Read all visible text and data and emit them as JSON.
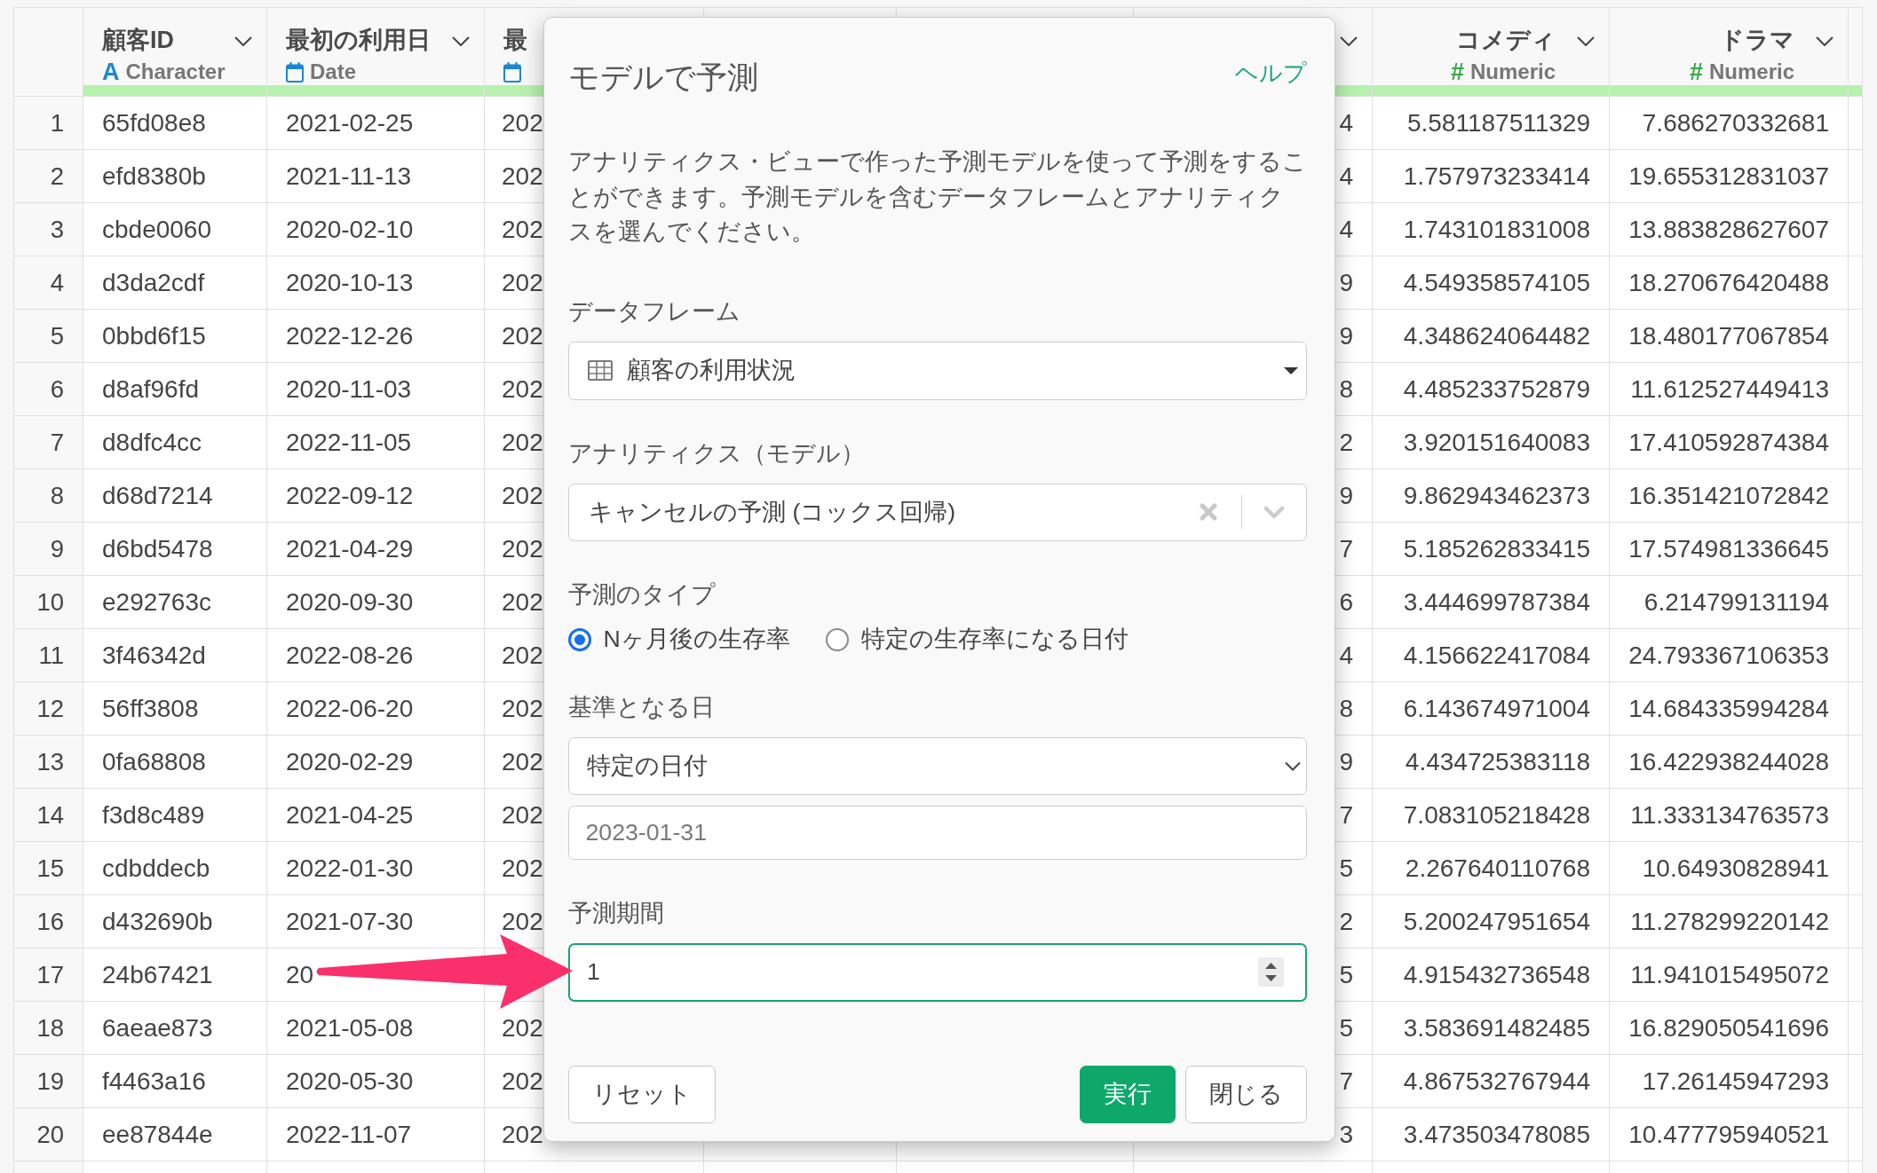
{
  "table": {
    "columns": [
      {
        "kind": "character",
        "name": "顧客ID",
        "type_mark": "A",
        "type_label": "Character",
        "menu": true
      },
      {
        "kind": "date",
        "name": "最初の利用日",
        "type_label": "Date",
        "menu": true
      },
      {
        "kind": "date",
        "name": "最"
      },
      {
        "kind": "numeric",
        "menu": true
      },
      {
        "kind": "numeric",
        "name": "コメディ",
        "type_mark": "#",
        "type_label": "Numeric",
        "menu": true
      },
      {
        "kind": "numeric",
        "name": "ドラマ",
        "type_mark": "#",
        "type_label": "Numeric",
        "menu": true
      }
    ],
    "rows": [
      {
        "number": "1",
        "cells": [
          "65fd08e8",
          "2021-02-25",
          "202",
          "4",
          "5.581187511329",
          "7.686270332681"
        ]
      },
      {
        "number": "2",
        "cells": [
          "efd8380b",
          "2021-11-13",
          "202",
          "4",
          "1.757973233414",
          "19.655312831037"
        ]
      },
      {
        "number": "3",
        "cells": [
          "cbde0060",
          "2020-02-10",
          "202",
          "4",
          "1.743101831008",
          "13.883828627607"
        ]
      },
      {
        "number": "4",
        "cells": [
          "d3da2cdf",
          "2020-10-13",
          "202",
          "9",
          "4.549358574105",
          "18.270676420488"
        ]
      },
      {
        "number": "5",
        "cells": [
          "0bbd6f15",
          "2022-12-26",
          "202",
          "9",
          "4.348624064482",
          "18.480177067854"
        ]
      },
      {
        "number": "6",
        "cells": [
          "d8af96fd",
          "2020-11-03",
          "202",
          "8",
          "4.485233752879",
          "11.612527449413"
        ]
      },
      {
        "number": "7",
        "cells": [
          "d8dfc4cc",
          "2022-11-05",
          "202",
          "2",
          "3.920151640083",
          "17.410592874384"
        ]
      },
      {
        "number": "8",
        "cells": [
          "d68d7214",
          "2022-09-12",
          "202",
          "9",
          "9.862943462373",
          "16.351421072842"
        ]
      },
      {
        "number": "9",
        "cells": [
          "d6bd5478",
          "2021-04-29",
          "202",
          "7",
          "5.185262833415",
          "17.574981336645"
        ]
      },
      {
        "number": "10",
        "cells": [
          "e292763c",
          "2020-09-30",
          "202",
          "6",
          "3.444699787384",
          "6.214799131194"
        ]
      },
      {
        "number": "11",
        "cells": [
          "3f46342d",
          "2022-08-26",
          "202",
          "4",
          "4.156622417084",
          "24.793367106353"
        ]
      },
      {
        "number": "12",
        "cells": [
          "56ff3808",
          "2022-06-20",
          "202",
          "8",
          "6.143674971004",
          "14.684335994284"
        ]
      },
      {
        "number": "13",
        "cells": [
          "0fa68808",
          "2020-02-29",
          "202",
          "9",
          "4.434725383118",
          "16.422938244028"
        ]
      },
      {
        "number": "14",
        "cells": [
          "f3d8c489",
          "2021-04-25",
          "202",
          "7",
          "7.083105218428",
          "11.333134763573"
        ]
      },
      {
        "number": "15",
        "cells": [
          "cdbddecb",
          "2022-01-30",
          "202",
          "5",
          "2.267640110768",
          "10.64930828941"
        ]
      },
      {
        "number": "16",
        "cells": [
          "d432690b",
          "2021-07-30",
          "202",
          "2",
          "5.200247951654",
          "11.278299220142"
        ]
      },
      {
        "number": "17",
        "cells": [
          "24b67421",
          "20",
          null,
          "5",
          "4.915432736548",
          "11.941015495072"
        ]
      },
      {
        "number": "18",
        "cells": [
          "6aeae873",
          "2021-05-08",
          "202",
          "5",
          "3.583691482485",
          "16.829050541696"
        ]
      },
      {
        "number": "19",
        "cells": [
          "f4463a16",
          "2020-05-30",
          "202",
          "7",
          "4.867532767944",
          "17.26145947293"
        ]
      },
      {
        "number": "20",
        "cells": [
          "ee87844e",
          "2022-11-07",
          "202",
          "3",
          "3.473503478085",
          "10.477795940521"
        ]
      }
    ]
  },
  "modal": {
    "title": "モデルで予測",
    "help_link": "ヘルプ",
    "description": "アナリティクス・ビューで作った予測モデルを使って予測をすることができます。予測モデルを含むデータフレームとアナリティクスを選んでください。",
    "fields": [
      {
        "kind": "dataframe-select",
        "label": "データフレーム",
        "value": "顧客の利用状況"
      },
      {
        "kind": "model-select",
        "label": "アナリティクス（モデル）",
        "value": "キャンセルの予測 (コックス回帰)"
      },
      {
        "kind": "radio",
        "label": "予測のタイプ",
        "options": [
          {
            "label": "Nヶ月後の生存率",
            "selected": true
          },
          {
            "label": "特定の生存率になる日付",
            "selected": false
          }
        ]
      },
      {
        "kind": "select",
        "label": "基準となる日",
        "value": "特定の日付"
      },
      {
        "kind": "date",
        "placeholder": "2023-01-31"
      },
      {
        "kind": "number",
        "label": "予測期間",
        "value": "1",
        "focused": true
      }
    ],
    "footer": {
      "left": [
        {
          "label": "リセット",
          "primary": false
        }
      ],
      "right": [
        {
          "label": "実行",
          "primary": true
        },
        {
          "label": "閉じる",
          "primary": false
        }
      ]
    }
  },
  "annotation": {
    "kind": "arrow"
  }
}
